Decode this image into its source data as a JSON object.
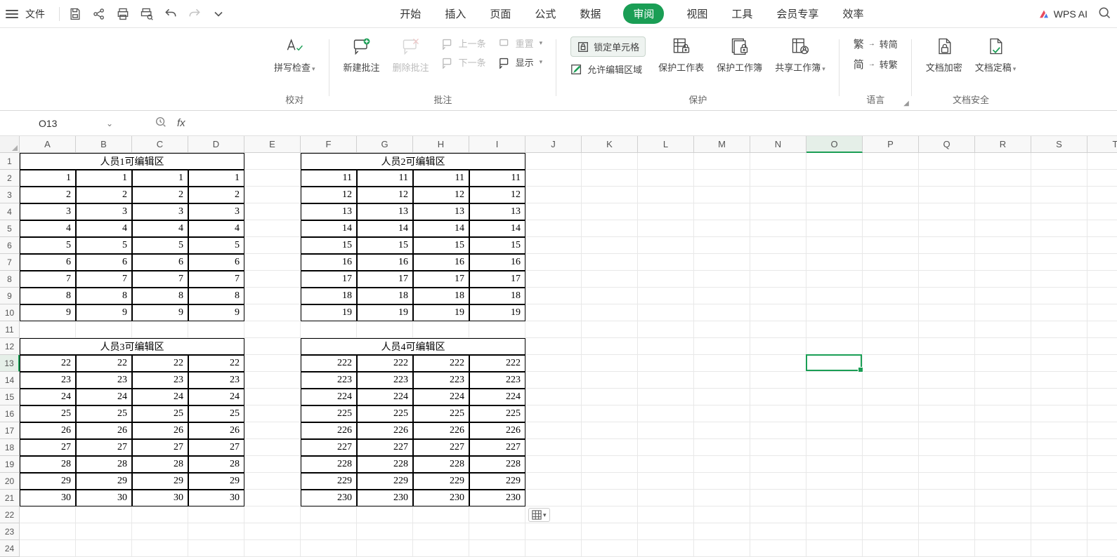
{
  "menubar": {
    "file": "文件",
    "tabs": [
      "开始",
      "插入",
      "页面",
      "公式",
      "数据",
      "审阅",
      "视图",
      "工具",
      "会员专享",
      "效率"
    ],
    "active_tab": "审阅",
    "wps_ai": "WPS AI"
  },
  "ribbon": {
    "group_proof": {
      "title": "校对",
      "spellcheck": "拼写检查"
    },
    "group_comment": {
      "title": "批注",
      "new": "新建批注",
      "delete": "删除批注",
      "prev": "上一条",
      "next": "下一条",
      "reset": "重置",
      "show": "显示"
    },
    "group_protect": {
      "title": "保护",
      "lock": "锁定单元格",
      "allow": "允许编辑区域",
      "sheet": "保护工作表",
      "book": "保护工作簿",
      "share": "共享工作簿"
    },
    "group_lang": {
      "title": "语言",
      "simp": "转简",
      "trad": "转繁"
    },
    "group_docsec": {
      "title": "文档安全",
      "encrypt": "文档加密",
      "final": "文档定稿"
    }
  },
  "refbar": {
    "cell": "O13"
  },
  "sheet": {
    "columns": [
      "A",
      "B",
      "C",
      "D",
      "E",
      "F",
      "G",
      "H",
      "I",
      "J",
      "K",
      "L",
      "M",
      "N",
      "O",
      "P",
      "Q",
      "R",
      "S",
      "T"
    ],
    "selected_col": "O",
    "selected_row": 13,
    "headers": {
      "r1_AD": "人员1可编辑区",
      "r1_FI": "人员2可编辑区",
      "r12_AD": "人员3可编辑区",
      "r12_FI": "人员4可编辑区"
    },
    "block1": [
      [
        1,
        1,
        1,
        1
      ],
      [
        2,
        2,
        2,
        2
      ],
      [
        3,
        3,
        3,
        3
      ],
      [
        4,
        4,
        4,
        4
      ],
      [
        5,
        5,
        5,
        5
      ],
      [
        6,
        6,
        6,
        6
      ],
      [
        7,
        7,
        7,
        7
      ],
      [
        8,
        8,
        8,
        8
      ],
      [
        9,
        9,
        9,
        9
      ]
    ],
    "block2": [
      [
        11,
        11,
        11,
        11
      ],
      [
        12,
        12,
        12,
        12
      ],
      [
        13,
        13,
        13,
        13
      ],
      [
        14,
        14,
        14,
        14
      ],
      [
        15,
        15,
        15,
        15
      ],
      [
        16,
        16,
        16,
        16
      ],
      [
        17,
        17,
        17,
        17
      ],
      [
        18,
        18,
        18,
        18
      ],
      [
        19,
        19,
        19,
        19
      ]
    ],
    "block3": [
      [
        22,
        22,
        22,
        22
      ],
      [
        23,
        23,
        23,
        23
      ],
      [
        24,
        24,
        24,
        24
      ],
      [
        25,
        25,
        25,
        25
      ],
      [
        26,
        26,
        26,
        26
      ],
      [
        27,
        27,
        27,
        27
      ],
      [
        28,
        28,
        28,
        28
      ],
      [
        29,
        29,
        29,
        29
      ],
      [
        30,
        30,
        30,
        30
      ]
    ],
    "block4": [
      [
        222,
        222,
        222,
        222
      ],
      [
        223,
        223,
        223,
        223
      ],
      [
        224,
        224,
        224,
        224
      ],
      [
        225,
        225,
        225,
        225
      ],
      [
        226,
        226,
        226,
        226
      ],
      [
        227,
        227,
        227,
        227
      ],
      [
        228,
        228,
        228,
        228
      ],
      [
        229,
        229,
        229,
        229
      ],
      [
        230,
        230,
        230,
        230
      ]
    ]
  }
}
